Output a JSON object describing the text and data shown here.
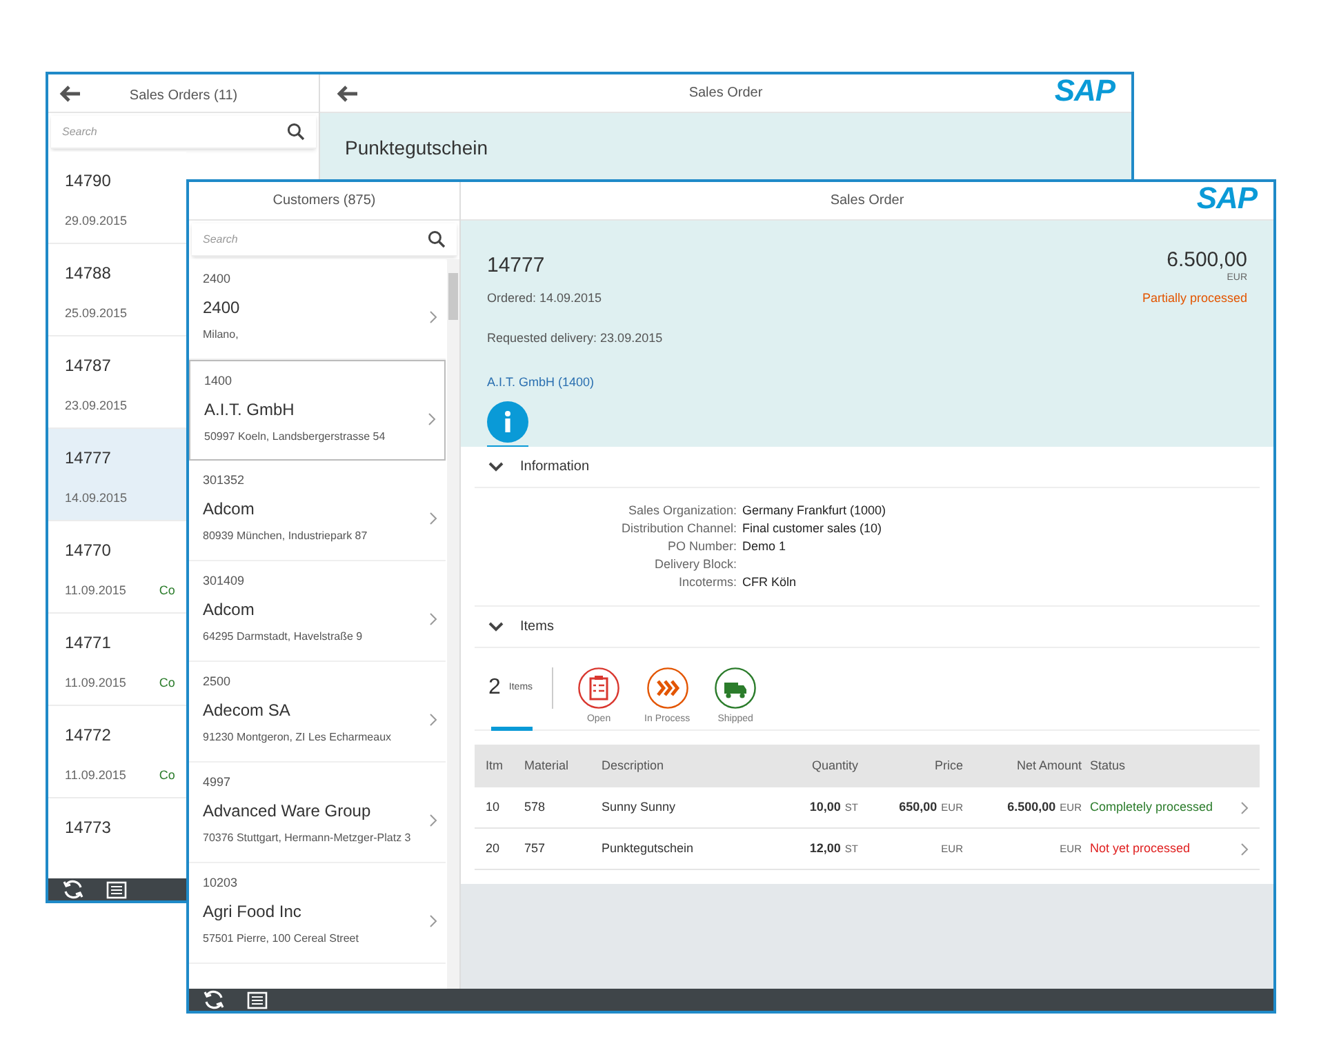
{
  "back_window": {
    "list_header": {
      "title": "Sales Orders (11)"
    },
    "search": {
      "placeholder": "Search"
    },
    "orders": [
      {
        "number": "14790",
        "date": "29.09.2015",
        "selected": false
      },
      {
        "number": "14788",
        "date": "25.09.2015",
        "selected": false
      },
      {
        "number": "14787",
        "date": "23.09.2015",
        "selected": false
      },
      {
        "number": "14777",
        "date": "14.09.2015",
        "selected": true
      },
      {
        "number": "14770",
        "date": "11.09.2015",
        "status": "Co",
        "color": "#2b7c2b",
        "selected": false
      },
      {
        "number": "14771",
        "date": "11.09.2015",
        "status": "Co",
        "color": "#2b7c2b",
        "selected": false
      },
      {
        "number": "14772",
        "date": "11.09.2015",
        "status": "Co",
        "color": "#2b7c2b",
        "selected": false
      },
      {
        "number": "14773",
        "selected": false
      }
    ],
    "detail_header": {
      "title": "Sales Order",
      "logo": "SAP"
    },
    "detail_title": "Punktegutschein"
  },
  "front_window": {
    "list_header": {
      "title": "Customers (875)"
    },
    "search": {
      "placeholder": "Search"
    },
    "customers": [
      {
        "id": "2400",
        "name": "2400",
        "address": "Milano,",
        "selected": false
      },
      {
        "id": "1400",
        "name": "A.I.T. GmbH",
        "address": "50997 Koeln, Landsbergerstrasse 54",
        "selected": true
      },
      {
        "id": "301352",
        "name": "Adcom",
        "address": "80939 München, Industriepark 87",
        "selected": false
      },
      {
        "id": "301409",
        "name": "Adcom",
        "address": "64295 Darmstadt, Havelstraße 9",
        "selected": false
      },
      {
        "id": "2500",
        "name": "Adecom SA",
        "address": "91230 Montgeron, ZI Les Echarmeaux",
        "selected": false
      },
      {
        "id": "4997",
        "name": "Advanced Ware Group",
        "address": "70376 Stuttgart, Hermann-Metzger-Platz 3",
        "selected": false
      },
      {
        "id": "10203",
        "name": "Agri Food Inc",
        "address": "57501 Pierre, 100 Cereal Street",
        "selected": false
      }
    ],
    "detail_header": {
      "title": "Sales Order",
      "logo": "SAP"
    },
    "object_header": {
      "number": "14777",
      "amount": "6.500,00",
      "currency": "EUR",
      "ordered": "Ordered: 14.09.2015",
      "requested_delivery": "Requested delivery: 23.09.2015",
      "customer_link": "A.I.T. GmbH (1400)",
      "status": "Partially processed"
    },
    "header_tabs": [
      {
        "kind": "info",
        "selected": true
      }
    ],
    "information": {
      "title": "Information",
      "expanded": true,
      "fields": [
        {
          "label": "Sales Organization:",
          "value": "Germany Frankfurt (1000)"
        },
        {
          "label": "Distribution Channel:",
          "value": "Final customer sales (10)"
        },
        {
          "label": "PO Number:",
          "value": "Demo 1"
        },
        {
          "label": "Delivery Block:"
        },
        {
          "label": "Incoterms:",
          "value": "CFR Köln"
        }
      ]
    },
    "items": {
      "title": "Items",
      "expanded": true,
      "tabs": [
        {
          "kind": "count",
          "count": "2",
          "label": "Items",
          "selected": true
        },
        {
          "kind": "open",
          "label": "Open",
          "selected": false
        },
        {
          "kind": "in_process",
          "label": "In Process",
          "selected": false
        },
        {
          "kind": "shipped",
          "label": "Shipped",
          "selected": false
        }
      ],
      "table": {
        "columns": [
          "Itm",
          "Material",
          "Description",
          "Quantity",
          "Price",
          "Net Amount",
          "Status"
        ],
        "rows": [
          {
            "item": "10",
            "material": "578",
            "description": "Sunny Sunny",
            "quantity": "10,00",
            "quantity_unit": "ST",
            "price": "650,00",
            "price_currency": "EUR",
            "net_amount": "6.500,00",
            "net_currency": "EUR",
            "status": "Completely processed",
            "color": "#2b7c2b"
          },
          {
            "item": "20",
            "material": "757",
            "description": "Punktegutschein",
            "quantity": "12,00",
            "quantity_unit": "ST",
            "price_currency": "EUR",
            "net_currency": "EUR",
            "status": "Not yet processed",
            "color": "#e02020"
          }
        ]
      }
    }
  }
}
